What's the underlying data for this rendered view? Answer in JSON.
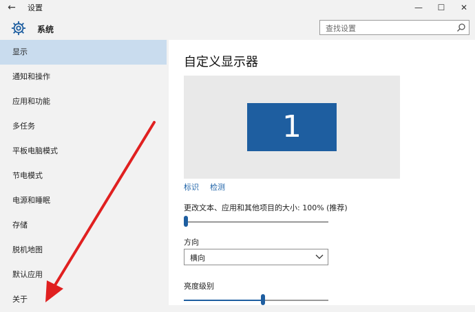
{
  "window": {
    "title": "设置",
    "back_icon": "back-arrow-icon",
    "min_icon": "minimize-icon",
    "max_icon": "maximize-icon",
    "close_icon": "close-icon"
  },
  "header": {
    "section_icon": "gear-icon",
    "section_title": "系统",
    "search_placeholder": "查找设置",
    "search_icon": "search-icon"
  },
  "sidebar": {
    "items": [
      {
        "label": "显示",
        "selected": true
      },
      {
        "label": "通知和操作",
        "selected": false
      },
      {
        "label": "应用和功能",
        "selected": false
      },
      {
        "label": "多任务",
        "selected": false
      },
      {
        "label": "平板电脑模式",
        "selected": false
      },
      {
        "label": "节电模式",
        "selected": false
      },
      {
        "label": "电源和睡眠",
        "selected": false
      },
      {
        "label": "存储",
        "selected": false
      },
      {
        "label": "脱机地图",
        "selected": false
      },
      {
        "label": "默认应用",
        "selected": false
      },
      {
        "label": "关于",
        "selected": false
      }
    ]
  },
  "main": {
    "title": "自定义显示器",
    "monitor_number": "1",
    "identify_link": "标识",
    "detect_link": "检测",
    "scale_label": "更改文本、应用和其他项目的大小: 100% (推荐)",
    "scale_level": 0.0,
    "orientation_label": "方向",
    "orientation_value": "横向",
    "brightness_label": "亮度级别",
    "brightness_level": 0.55
  },
  "colors": {
    "accent": "#1e5ea0",
    "selected_bg": "#c9dcee",
    "annotation_arrow": "#e02020"
  }
}
